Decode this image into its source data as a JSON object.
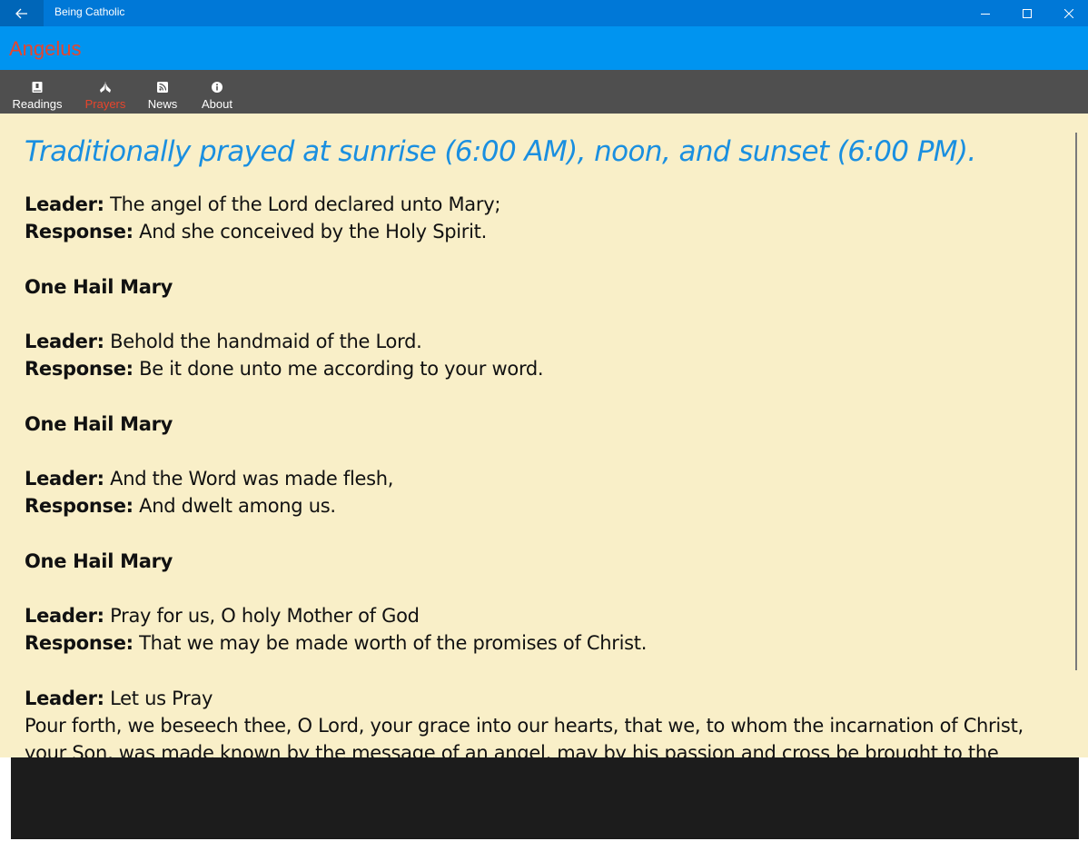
{
  "window": {
    "app_title": "Being Catholic",
    "back_icon": "arrow-left-icon",
    "minimize_icon": "minimize-icon",
    "maximize_icon": "maximize-icon",
    "close_icon": "close-icon"
  },
  "header": {
    "page_title": "Angelus"
  },
  "nav": {
    "items": [
      {
        "label": "Readings",
        "icon": "book-icon"
      },
      {
        "label": "Prayers",
        "icon": "praying-hands-icon",
        "active": true
      },
      {
        "label": "News",
        "icon": "rss-icon"
      },
      {
        "label": "About",
        "icon": "info-icon"
      }
    ]
  },
  "content": {
    "subtitle": "Traditionally prayed at sunrise (6:00 AM), noon, and sunset (6:00 PM).",
    "blocks": [
      {
        "leader_label": "Leader:",
        "leader_text": "The angel of the Lord declared unto Mary;",
        "response_label": "Response:",
        "response_text": "And she conceived by the Holy Spirit."
      },
      {
        "heading": "One Hail Mary"
      },
      {
        "leader_label": "Leader:",
        "leader_text": "Behold the handmaid of the Lord.",
        "response_label": "Response:",
        "response_text": "Be it done unto me according to your word."
      },
      {
        "heading": "One Hail Mary"
      },
      {
        "leader_label": "Leader:",
        "leader_text": "And the Word was made flesh,",
        "response_label": "Response:",
        "response_text": "And dwelt among us."
      },
      {
        "heading": "One Hail Mary"
      },
      {
        "leader_label": "Leader:",
        "leader_text": "Pray for us, O holy Mother of God",
        "response_label": "Response:",
        "response_text": "That we may be made worth of the promises of Christ."
      },
      {
        "leader_label": "Leader:",
        "leader_text": "Let us Pray",
        "closing_text": "Pour forth, we beseech thee, O Lord, your grace into our hearts, that we, to whom the incarnation of Christ, your Son, was made known by the message of an angel, may by his passion and cross be brought to the glory of his"
      }
    ]
  },
  "colors": {
    "titlebar": "#0078d7",
    "header": "#0094f0",
    "navbar": "#4f4f4f",
    "accent": "#e8452c",
    "content_bg": "#f9efc8",
    "subtitle": "#1a8fe0",
    "bottom_bar": "#1c1c1c"
  }
}
